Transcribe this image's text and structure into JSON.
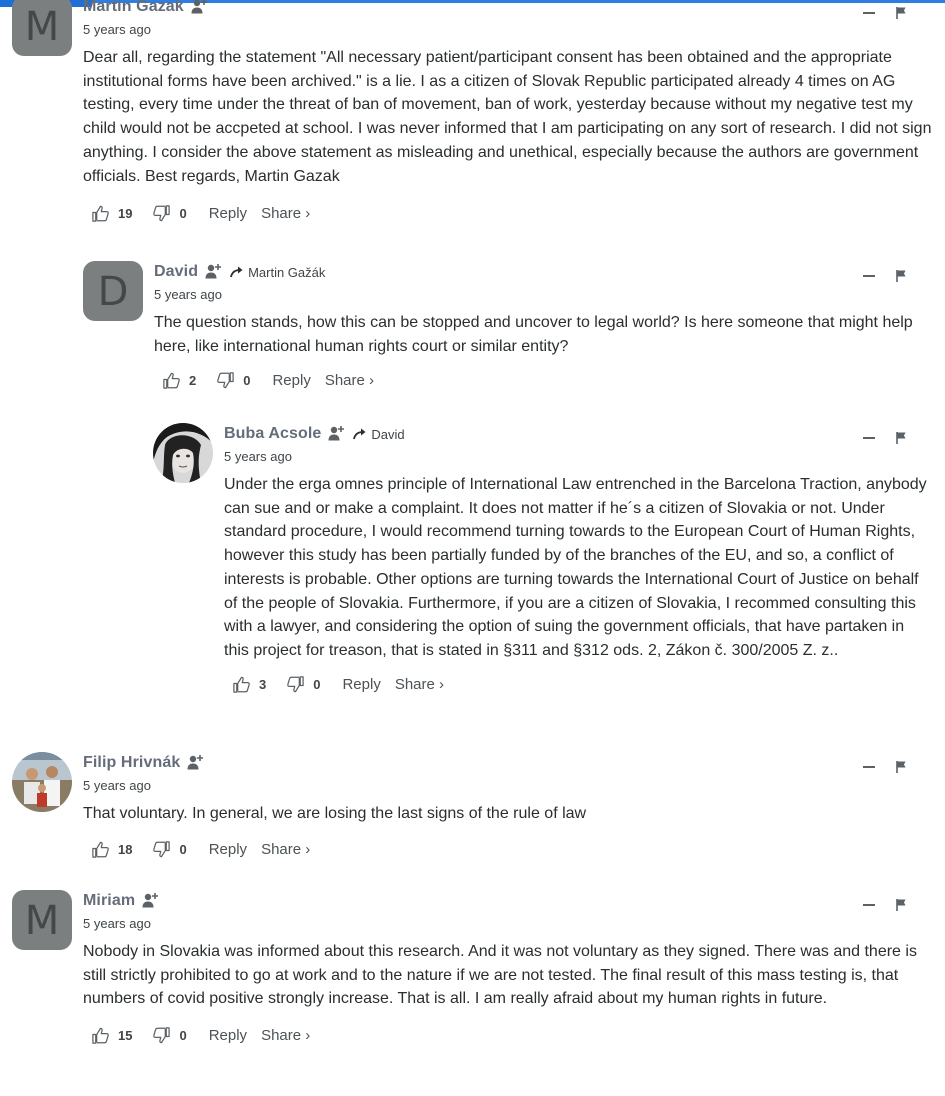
{
  "comments": [
    {
      "id": "c1",
      "author": "Martin Gazak",
      "avatar_letter": "M",
      "time": "5 years ago",
      "reply_to": "",
      "text": "Dear all, regarding the statement \"All necessary patient/participant consent has been obtained and the appropriate institutional forms have been archived.\" is a lie. I as a citizen of Slovak Republic participated already 4 times on AG testing, every time under the threat of ban of movement, ban of work, yesterday because without my negative test my child would not be accpeted at school. I was never informed that I am participating on any sort of research. I did not sign anything. I consider the above statement as misleading and unethical, especially because the authors are government officials. Best regards, Martin Gazak",
      "upvotes": "19",
      "downvotes": "0"
    },
    {
      "id": "c2",
      "author": "David",
      "avatar_letter": "D",
      "time": "5 years ago",
      "reply_to": "Martin Gažák",
      "text": "The question stands, how this can be stopped and uncover to legal world? Is here someone that might help here, like international human rights court or similar entity?",
      "upvotes": "2",
      "downvotes": "0"
    },
    {
      "id": "c3",
      "author": "Buba Acsole",
      "avatar_letter": "",
      "time": "5 years ago",
      "reply_to": "David",
      "text": "Under the erga omnes principle of International Law entrenched in the Barcelona Traction, anybody can sue and or make a complaint. It does not matter if he´s a citizen of Slovakia or not. Under standard procedure, I would recommend turning towards to the European Court of Human Rights, however this study has been partially funded by of the branches of the EU, and so, a conflict of interests is probable. Other options are turning towards the International Court of Justice on behalf of the people of Slovakia. Furthermore, if you are a citizen of Slovakia, I recommed consulting this with a lawyer, and considering the option of suing the government officials, that have partaken in this project for treason, that is stated in §311 and §312 ods. 2, Zákon č. 300/2005 Z. z..",
      "upvotes": "3",
      "downvotes": "0"
    },
    {
      "id": "c4",
      "author": "Filip Hrivnák",
      "avatar_letter": "",
      "time": "5 years ago",
      "reply_to": "",
      "text": "That voluntary. In general, we are losing the last signs of the rule of law",
      "upvotes": "18",
      "downvotes": "0"
    },
    {
      "id": "c5",
      "author": "Miriam",
      "avatar_letter": "M",
      "time": "5 years ago",
      "reply_to": "",
      "text": "Nobody in Slovakia was informed about this research. And it was not voluntary as they signed. There was and there is still strictly prohibited to go at work and to the nature if we are not tested. The final result of this mass testing is, that numbers of covid positive strongly increase. That is all. I am really afraid about my human rights in future.",
      "upvotes": "15",
      "downvotes": "0"
    }
  ],
  "labels": {
    "reply": "Reply",
    "share": "Share ›"
  },
  "colors": {
    "avatar_bg": "#7b7f80",
    "accent": "#2e7de0",
    "text": "#2a2e2e",
    "author": "#656c7a"
  },
  "icons": {
    "follow": "add-user-icon",
    "reply_arrow": "reply-arrow-icon",
    "upvote": "thumbs-up-icon",
    "downvote": "thumbs-down-icon",
    "collapse": "collapse-icon",
    "flag": "flag-icon"
  }
}
